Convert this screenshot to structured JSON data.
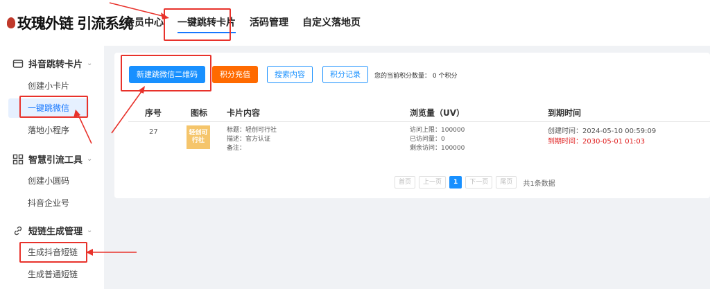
{
  "brand": {
    "logo_text": "玫瑰外链 引流系统"
  },
  "topnav": [
    {
      "label": "会员中心"
    },
    {
      "label": "一键跳转卡片",
      "active": true
    },
    {
      "label": "活码管理"
    },
    {
      "label": "自定义落地页"
    }
  ],
  "sidebar": {
    "groups": [
      {
        "label": "抖音跳转卡片",
        "icon": "card-icon",
        "items": [
          "创建小卡片",
          "一键跳微信",
          "落地小程序"
        ]
      },
      {
        "label": "智慧引流工具",
        "icon": "grid-icon",
        "items": [
          "创建小圆码",
          "抖音企业号"
        ]
      },
      {
        "label": "短链生成管理",
        "icon": "link-icon",
        "items": [
          "生成抖音短链",
          "生成普通短链"
        ]
      }
    ],
    "active_item": "一键跳微信"
  },
  "toolbar": {
    "new_button": "新建跳微信二维码",
    "recharge_button": "积分充值",
    "search_button": "搜索内容",
    "records_button": "积分记录",
    "points_text": "您的当前积分数量： 0 个积分"
  },
  "table": {
    "columns": [
      "序号",
      "图标",
      "卡片内容",
      "浏览量（UV）",
      "到期时间"
    ],
    "rows": [
      {
        "index": "27",
        "thumb_text": "轻创可行社",
        "content": [
          "标题：轻创可行社",
          "描述：官方认证",
          "备注："
        ],
        "views": [
          "访问上限：100000",
          "已访问量：0",
          "剩余访问：100000"
        ],
        "created": "创建时间：2024-05-10 00:59:09",
        "expires": "到期时间：2030-05-01 01:03"
      }
    ]
  },
  "pagination": {
    "first": "首页",
    "prev": "上一页",
    "current": "1",
    "next": "下一页",
    "last": "尾页",
    "total": "共1条数据"
  },
  "colors": {
    "primary": "#1890ff",
    "orange": "#ff6a00",
    "annotation": "#e8322b",
    "expire": "#e02020"
  }
}
